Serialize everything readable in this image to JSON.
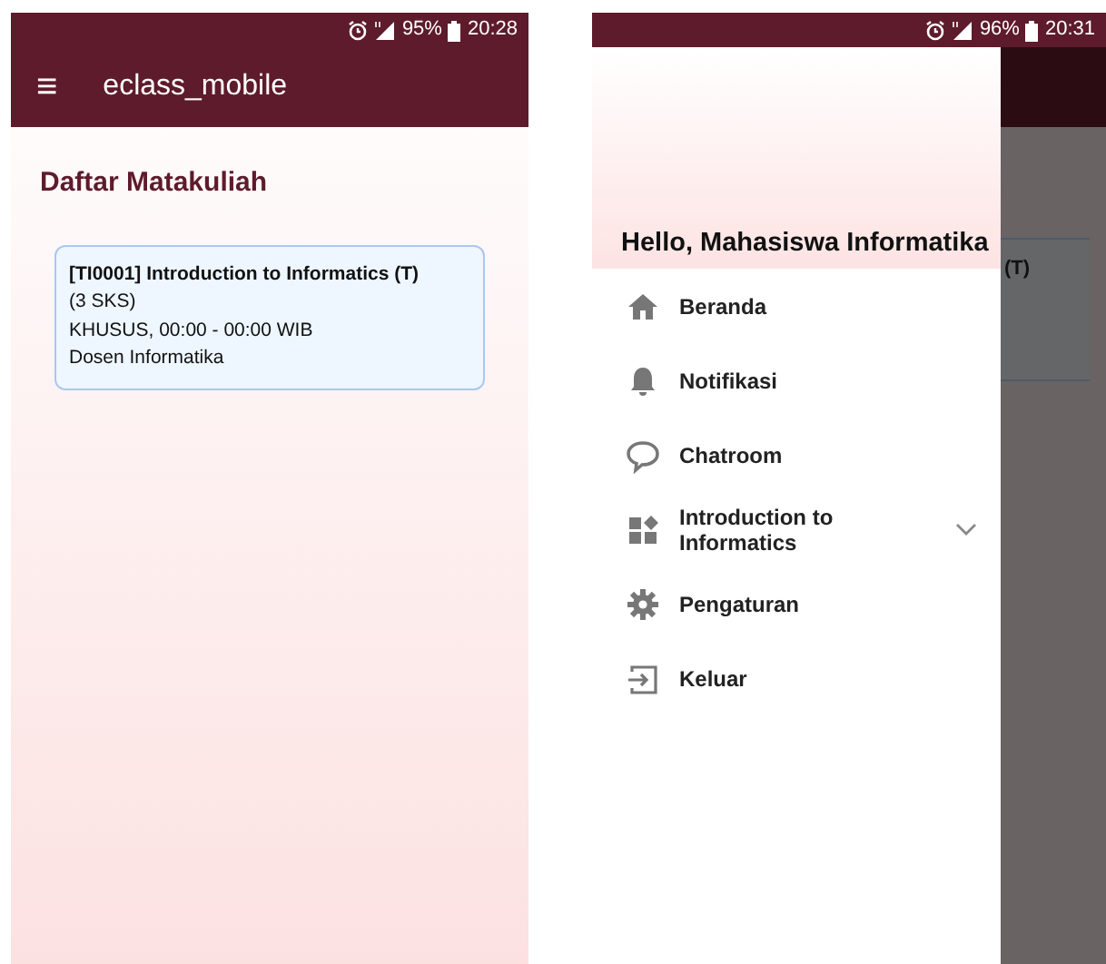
{
  "screens": [
    {
      "status_bar": {
        "battery": "95%",
        "time": "20:28"
      },
      "app_bar": {
        "menu_icon": "≡",
        "title": "eclass_mobile"
      },
      "heading": "Daftar Matakuliah",
      "courses": [
        {
          "title": "[TI0001] Introduction to Informatics (T)",
          "credits": "(3 SKS)",
          "schedule": "KHUSUS, 00:00 - 00:00 WIB",
          "lecturer": "Dosen Informatika"
        }
      ]
    },
    {
      "status_bar": {
        "battery": "96%",
        "time": "20:31"
      },
      "background_card_text": "(T)",
      "drawer": {
        "greeting": "Hello, Mahasiswa Informatika",
        "items": [
          {
            "kind": "home",
            "label": "Beranda"
          },
          {
            "kind": "bell",
            "label": "Notifikasi"
          },
          {
            "kind": "chat",
            "label": "Chatroom"
          },
          {
            "kind": "widgets",
            "label": "Introduction to Informatics",
            "expanded": false
          },
          {
            "kind": "gear",
            "label": "Pengaturan"
          },
          {
            "kind": "exit",
            "label": "Keluar"
          }
        ]
      }
    }
  ]
}
